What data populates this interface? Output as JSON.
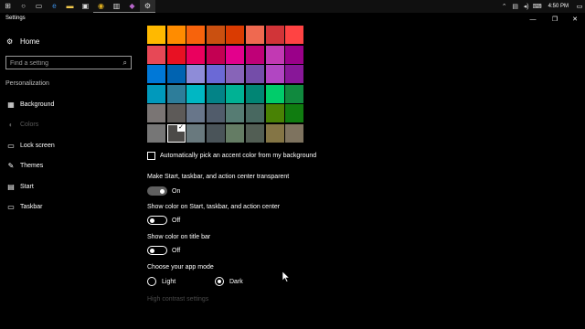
{
  "taskbar": {
    "icons": [
      {
        "name": "windows-start-icon",
        "glyph": "⊞"
      },
      {
        "name": "cortana-icon",
        "glyph": "○"
      },
      {
        "name": "task-view-icon",
        "glyph": "▭"
      },
      {
        "name": "edge-icon",
        "glyph": "e"
      },
      {
        "name": "file-explorer-icon",
        "glyph": "▬"
      },
      {
        "name": "store-icon",
        "glyph": "▣"
      },
      {
        "name": "chrome-icon",
        "glyph": "◉"
      },
      {
        "name": "photos-icon",
        "glyph": "▥"
      },
      {
        "name": "app-icon",
        "glyph": "◆"
      },
      {
        "name": "settings-icon",
        "glyph": "⚙"
      }
    ],
    "tray": {
      "chevron": "⌃",
      "network": "▤",
      "volume": "◂)",
      "keyboard": "⌨",
      "clock": "4:50 PM",
      "notification": "▭"
    }
  },
  "window": {
    "title": "Settings",
    "minimize": "—",
    "maximize": "❐",
    "close": "✕"
  },
  "sidebar": {
    "home_icon": "⚙",
    "home_label": "Home",
    "search_placeholder": "Find a setting",
    "search_icon": "⌕",
    "section_title": "Personalization",
    "items": [
      {
        "icon": "▦",
        "label": "Background"
      },
      {
        "icon": "◐",
        "label": "Colors"
      },
      {
        "icon": "▭",
        "label": "Lock screen"
      },
      {
        "icon": "✎",
        "label": "Themes"
      },
      {
        "icon": "▤",
        "label": "Start"
      },
      {
        "icon": "▭",
        "label": "Taskbar"
      }
    ]
  },
  "colors": {
    "grid": [
      [
        "#FFB900",
        "#FF8C00",
        "#F7630C",
        "#CA5010",
        "#DA3B01",
        "#EF6950",
        "#D13438",
        "#FF4343"
      ],
      [
        "#E74856",
        "#E81123",
        "#EA005E",
        "#C30052",
        "#E3008C",
        "#BF0077",
        "#C239B3",
        "#9A0089"
      ],
      [
        "#0078D7",
        "#0063B1",
        "#8E8CD8",
        "#6B69D6",
        "#8764B8",
        "#744DA9",
        "#B146C2",
        "#881798"
      ],
      [
        "#0099BC",
        "#2D7D9A",
        "#00B7C3",
        "#038387",
        "#00B294",
        "#018574",
        "#00CC6A",
        "#10893E"
      ],
      [
        "#7A7574",
        "#5D5A58",
        "#68768A",
        "#515C6B",
        "#567C73",
        "#486860",
        "#498205",
        "#107C10"
      ],
      [
        "#767676",
        "#4C4A48",
        "#69797E",
        "#4A5459",
        "#647C64",
        "#525E54",
        "#847545",
        "#7E735F"
      ]
    ],
    "selected": "#4C4A48",
    "check_glyph": "✓",
    "auto_pick_label": "Automatically pick an accent color from my background",
    "transparency": {
      "label": "Make Start, taskbar, and action center transparent",
      "state": "On"
    },
    "show_on_start": {
      "label": "Show color on Start, taskbar, and action center",
      "state": "Off"
    },
    "show_on_titlebar": {
      "label": "Show color on title bar",
      "state": "Off"
    },
    "app_mode": {
      "label": "Choose your app mode",
      "options": [
        "Light",
        "Dark"
      ],
      "selected": "Dark"
    },
    "high_contrast_link": "High contrast settings"
  }
}
